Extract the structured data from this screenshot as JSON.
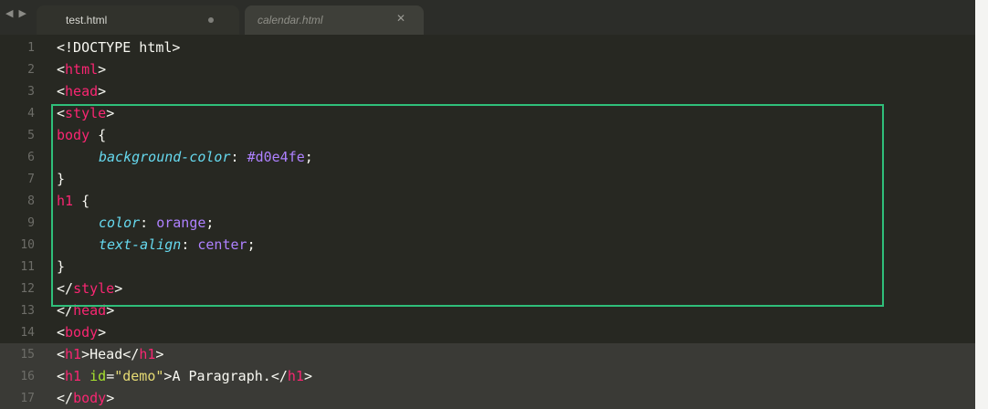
{
  "tabs": [
    {
      "label": "test.html",
      "active": true,
      "modified": true
    },
    {
      "label": "calendar.html",
      "active": false
    }
  ],
  "editor": {
    "lines": [
      {
        "num": "1",
        "text": "<!DOCTYPE html>"
      },
      {
        "num": "2",
        "text": "<html>"
      },
      {
        "num": "3",
        "text": "<head>"
      },
      {
        "num": "4",
        "text": "<style>"
      },
      {
        "num": "5",
        "text": "body {"
      },
      {
        "num": "6",
        "text": "background-color: #d0e4fe;"
      },
      {
        "num": "7",
        "text": "}"
      },
      {
        "num": "8",
        "text": "h1 {"
      },
      {
        "num": "9",
        "text": "color: orange;"
      },
      {
        "num": "10",
        "text": "text-align: center;"
      },
      {
        "num": "11",
        "text": "}"
      },
      {
        "num": "12",
        "text": "</style>"
      },
      {
        "num": "13",
        "text": "</head>"
      },
      {
        "num": "14",
        "text": "<body>"
      },
      {
        "num": "15",
        "text": "<h1>Head</h1>"
      },
      {
        "num": "16",
        "text": "<h1 id=\"demo\">A Paragraph.</h1>"
      },
      {
        "num": "17",
        "text": "</body>"
      }
    ]
  },
  "tokens": {
    "l1": "<!DOCTYPE html>",
    "lt": "<",
    "gt": ">",
    "lts": "</",
    "html": "html",
    "head": "head",
    "style": "style",
    "body": "body",
    "h1": "h1",
    "sel_body": "body",
    "brace_open": " {",
    "brace_close": "}",
    "p_bg": "background-color",
    "colon": ": ",
    "v_bg": "#d0e4fe",
    "semi": ";",
    "sel_h1": "h1",
    "p_color": "color",
    "v_color": "orange",
    "p_align": "text-align",
    "v_align": "center",
    "head_text": "Head",
    "id_attr": " id",
    "eq": "=",
    "id_val": "\"demo\"",
    "para_text": "A Paragraph."
  },
  "colors": {
    "background": "#272822",
    "tag": "#f92672",
    "property": "#66d9ef",
    "value": "#ae81ff",
    "highlight_box": "#2fbf7a"
  }
}
